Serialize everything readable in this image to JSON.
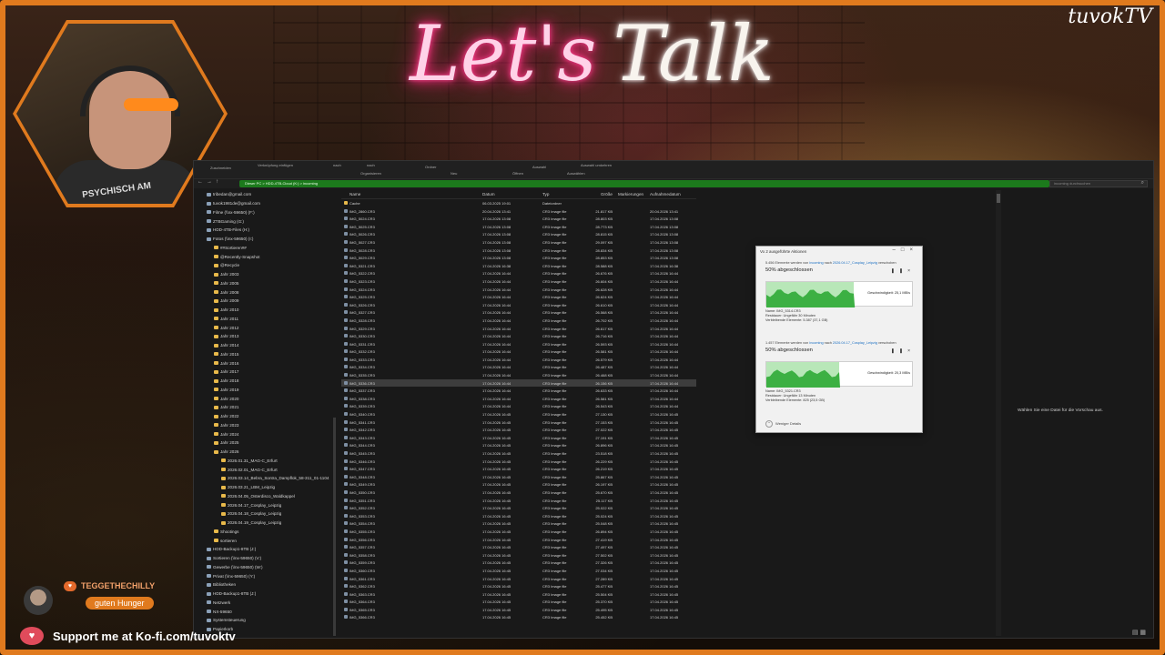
{
  "stream": {
    "title_part1": "Let's",
    "title_part2": "Talk",
    "brand": "tuvokTV",
    "shirt_text": "PSYCHISCH AM",
    "chat": {
      "user": "TEGGETHECHILLY",
      "message": "guten Hunger"
    },
    "support_text": "Support me at Ko-fi.com/tuvoktv",
    "accent_color": "#e07a1e"
  },
  "explorer": {
    "ribbon": [
      "Zuschneiden",
      "Verknüpfung einfügen",
      "nach",
      "nach",
      "Ordner",
      "Auswahl",
      "Auswahl umkehren",
      "Organisieren",
      "Neu",
      "Öffnen",
      "Auswählen"
    ],
    "address_path": "Dieser PC  >  HDD-4TB-Cloud (K:)  >  incoming",
    "search_placeholder": "incoming durchsuchen",
    "nav_items": [
      {
        "label": "tribedan@gmail.com",
        "kind": "drive"
      },
      {
        "label": "tuvok1981de@gmail.com",
        "kind": "drive"
      },
      {
        "label": "Filme (\\\\nx-59650) (F:)",
        "kind": "drive"
      },
      {
        "label": "ZTBGaming (G:)",
        "kind": "drive"
      },
      {
        "label": "HDD-4TB-Files (H:)",
        "kind": "drive"
      },
      {
        "label": "Fotos (\\\\nx-59650) (I:)",
        "kind": "drive"
      },
      {
        "label": "##Sortieren##",
        "kind": "folder"
      },
      {
        "label": "@Recently-Snapshot",
        "kind": "folder"
      },
      {
        "label": "@Recycle",
        "kind": "folder"
      },
      {
        "label": "Jahr 2003",
        "kind": "folder"
      },
      {
        "label": "Jahr 2005",
        "kind": "folder"
      },
      {
        "label": "Jahr 2008",
        "kind": "folder"
      },
      {
        "label": "Jahr 2009",
        "kind": "folder"
      },
      {
        "label": "Jahr 2010",
        "kind": "folder"
      },
      {
        "label": "Jahr 2011",
        "kind": "folder"
      },
      {
        "label": "Jahr 2012",
        "kind": "folder"
      },
      {
        "label": "Jahr 2013",
        "kind": "folder"
      },
      {
        "label": "Jahr 2014",
        "kind": "folder"
      },
      {
        "label": "Jahr 2015",
        "kind": "folder"
      },
      {
        "label": "Jahr 2016",
        "kind": "folder"
      },
      {
        "label": "Jahr 2017",
        "kind": "folder"
      },
      {
        "label": "Jahr 2018",
        "kind": "folder"
      },
      {
        "label": "Jahr 2019",
        "kind": "folder"
      },
      {
        "label": "Jahr 2020",
        "kind": "folder"
      },
      {
        "label": "Jahr 2021",
        "kind": "folder"
      },
      {
        "label": "Jahr 2022",
        "kind": "folder"
      },
      {
        "label": "Jahr 2023",
        "kind": "folder"
      },
      {
        "label": "Jahr 2024",
        "kind": "folder"
      },
      {
        "label": "Jahr 2025",
        "kind": "folder"
      },
      {
        "label": "Jahr 2026",
        "kind": "folder"
      },
      {
        "label": "2026.01.31_MAG-C_Erfurt",
        "kind": "folder"
      },
      {
        "label": "2026.02.01_MAG-C_Erfurt",
        "kind": "folder"
      },
      {
        "label": "2026.03.14_Bebra_Sontra_Dampflok_58-311_01-1104",
        "kind": "folder"
      },
      {
        "label": "2026.03.21_LBM_Leipzig",
        "kind": "folder"
      },
      {
        "label": "2026.04.05_Osterdisco_Waldkappel",
        "kind": "folder"
      },
      {
        "label": "2026.04.17_Cosplay_Leipzig",
        "kind": "folder"
      },
      {
        "label": "2026.04.18_Cosplay_Leipzig",
        "kind": "folder"
      },
      {
        "label": "2026.04.19_Cosplay_Leipzig",
        "kind": "folder"
      },
      {
        "label": "Shootings",
        "kind": "folder"
      },
      {
        "label": "sortieren",
        "kind": "folder"
      },
      {
        "label": "HDD-Backup1-8TB (J:)",
        "kind": "drive"
      },
      {
        "label": "Sortieren (\\\\nx-59650) (V:)",
        "kind": "drive"
      },
      {
        "label": "Gewerbe (\\\\nx-59650) (W:)",
        "kind": "drive"
      },
      {
        "label": "Privat (\\\\nx-59650) (Y:)",
        "kind": "drive"
      },
      {
        "label": "Bibliotheken",
        "kind": "drive"
      },
      {
        "label": "HDD-Backup1-8TB (J:)",
        "kind": "drive"
      },
      {
        "label": "Netzwerk",
        "kind": "drive"
      },
      {
        "label": "NX-59650",
        "kind": "drive"
      },
      {
        "label": "Systemsteuerung",
        "kind": "drive"
      },
      {
        "label": "Papierkorb",
        "kind": "drive"
      }
    ],
    "columns": {
      "name": "Name",
      "date": "Datum",
      "type": "Typ",
      "size": "Größe",
      "marks": "Markierungen",
      "shot": "Aufnahmedatum"
    },
    "files": [
      {
        "name": "Cache",
        "date": "06.03.2025 19:01",
        "type": "Dateiordner",
        "size": "",
        "shot": "",
        "folder": true
      },
      {
        "name": "IMG_2860.CR3",
        "date": "20.04.2026 13:41",
        "type": "CR3 Image file",
        "size": "21.817 KB",
        "shot": "20.04.2026 13:41"
      },
      {
        "name": "IMG_5024.CR3",
        "date": "17.04.2026 13:08",
        "type": "CR3 Image file",
        "size": "28.803 KB",
        "shot": "17.04.2026 13:08"
      },
      {
        "name": "IMG_5025.CR3",
        "date": "17.04.2026 13:08",
        "type": "CR3 Image file",
        "size": "28.773 KB",
        "shot": "17.04.2026 13:08"
      },
      {
        "name": "IMG_5026.CR3",
        "date": "17.04.2026 13:08",
        "type": "CR3 Image file",
        "size": "28.815 KB",
        "shot": "17.04.2026 13:08"
      },
      {
        "name": "IMG_5027.CR3",
        "date": "17.04.2026 13:08",
        "type": "CR3 Image file",
        "size": "29.097 KB",
        "shot": "17.04.2026 13:08"
      },
      {
        "name": "IMG_5028.CR3",
        "date": "17.04.2026 13:08",
        "type": "CR3 Image file",
        "size": "28.834 KB",
        "shot": "17.04.2026 13:08"
      },
      {
        "name": "IMG_5029.CR3",
        "date": "17.04.2026 13:08",
        "type": "CR3 Image file",
        "size": "28.853 KB",
        "shot": "17.04.2026 13:08"
      },
      {
        "name": "IMG_5321.CR3",
        "date": "17.04.2026 16:38",
        "type": "CR3 Image file",
        "size": "28.588 KB",
        "shot": "17.04.2026 16:38"
      },
      {
        "name": "IMG_5322.CR3",
        "date": "17.04.2026 16:44",
        "type": "CR3 Image file",
        "size": "26.676 KB",
        "shot": "17.04.2026 16:44"
      },
      {
        "name": "IMG_5323.CR3",
        "date": "17.04.2026 16:44",
        "type": "CR3 Image file",
        "size": "26.604 KB",
        "shot": "17.04.2026 16:44"
      },
      {
        "name": "IMG_5324.CR3",
        "date": "17.04.2026 16:44",
        "type": "CR3 Image file",
        "size": "26.628 KB",
        "shot": "17.04.2026 16:44"
      },
      {
        "name": "IMG_5325.CR3",
        "date": "17.04.2026 16:44",
        "type": "CR3 Image file",
        "size": "26.624 KB",
        "shot": "17.04.2026 16:44"
      },
      {
        "name": "IMG_5326.CR3",
        "date": "17.04.2026 16:44",
        "type": "CR3 Image file",
        "size": "26.610 KB",
        "shot": "17.04.2026 16:44"
      },
      {
        "name": "IMG_5327.CR3",
        "date": "17.04.2026 16:44",
        "type": "CR3 Image file",
        "size": "26.568 KB",
        "shot": "17.04.2026 16:44"
      },
      {
        "name": "IMG_5328.CR3",
        "date": "17.04.2026 16:44",
        "type": "CR3 Image file",
        "size": "26.702 KB",
        "shot": "17.04.2026 16:44"
      },
      {
        "name": "IMG_5329.CR3",
        "date": "17.04.2026 16:44",
        "type": "CR3 Image file",
        "size": "26.617 KB",
        "shot": "17.04.2026 16:44"
      },
      {
        "name": "IMG_5330.CR3",
        "date": "17.04.2026 16:44",
        "type": "CR3 Image file",
        "size": "26.716 KB",
        "shot": "17.04.2026 16:44"
      },
      {
        "name": "IMG_5331.CR3",
        "date": "17.04.2026 16:44",
        "type": "CR3 Image file",
        "size": "26.593 KB",
        "shot": "17.04.2026 16:44"
      },
      {
        "name": "IMG_5332.CR3",
        "date": "17.04.2026 16:44",
        "type": "CR3 Image file",
        "size": "26.581 KB",
        "shot": "17.04.2026 16:44"
      },
      {
        "name": "IMG_5333.CR3",
        "date": "17.04.2026 16:44",
        "type": "CR3 Image file",
        "size": "26.579 KB",
        "shot": "17.04.2026 16:44"
      },
      {
        "name": "IMG_5334.CR3",
        "date": "17.04.2026 16:44",
        "type": "CR3 Image file",
        "size": "26.487 KB",
        "shot": "17.04.2026 16:44"
      },
      {
        "name": "IMG_5335.CR3",
        "date": "17.04.2026 16:44",
        "type": "CR3 Image file",
        "size": "26.468 KB",
        "shot": "17.04.2026 16:44"
      },
      {
        "name": "IMG_5336.CR3",
        "date": "17.04.2026 16:44",
        "type": "CR3 Image file",
        "size": "26.156 KB",
        "shot": "17.04.2026 16:44",
        "selected": true
      },
      {
        "name": "IMG_5337.CR3",
        "date": "17.04.2026 16:44",
        "type": "CR3 Image file",
        "size": "26.633 KB",
        "shot": "17.04.2026 16:44"
      },
      {
        "name": "IMG_5338.CR3",
        "date": "17.04.2026 16:44",
        "type": "CR3 Image file",
        "size": "26.581 KB",
        "shot": "17.04.2026 16:44"
      },
      {
        "name": "IMG_5339.CR3",
        "date": "17.04.2026 16:44",
        "type": "CR3 Image file",
        "size": "26.543 KB",
        "shot": "17.04.2026 16:44"
      },
      {
        "name": "IMG_5340.CR3",
        "date": "17.04.2026 16:45",
        "type": "CR3 Image file",
        "size": "27.130 KB",
        "shot": "17.04.2026 16:45"
      },
      {
        "name": "IMG_5341.CR3",
        "date": "17.04.2026 16:45",
        "type": "CR3 Image file",
        "size": "27.153 KB",
        "shot": "17.04.2026 16:45"
      },
      {
        "name": "IMG_5342.CR3",
        "date": "17.04.2026 16:45",
        "type": "CR3 Image file",
        "size": "27.022 KB",
        "shot": "17.04.2026 16:45"
      },
      {
        "name": "IMG_5343.CR3",
        "date": "17.04.2026 16:45",
        "type": "CR3 Image file",
        "size": "27.191 KB",
        "shot": "17.04.2026 16:45"
      },
      {
        "name": "IMG_5344.CR3",
        "date": "17.04.2026 16:45",
        "type": "CR3 Image file",
        "size": "26.896 KB",
        "shot": "17.04.2026 16:45"
      },
      {
        "name": "IMG_5345.CR3",
        "date": "17.04.2026 16:45",
        "type": "CR3 Image file",
        "size": "23.518 KB",
        "shot": "17.04.2026 16:45"
      },
      {
        "name": "IMG_5346.CR3",
        "date": "17.04.2026 16:45",
        "type": "CR3 Image file",
        "size": "26.229 KB",
        "shot": "17.04.2026 16:45"
      },
      {
        "name": "IMG_5347.CR3",
        "date": "17.04.2026 16:45",
        "type": "CR3 Image file",
        "size": "26.219 KB",
        "shot": "17.04.2026 16:45"
      },
      {
        "name": "IMG_5348.CR3",
        "date": "17.04.2026 16:45",
        "type": "CR3 Image file",
        "size": "25.867 KB",
        "shot": "17.04.2026 16:45"
      },
      {
        "name": "IMG_5349.CR3",
        "date": "17.04.2026 16:45",
        "type": "CR3 Image file",
        "size": "26.197 KB",
        "shot": "17.04.2026 16:45"
      },
      {
        "name": "IMG_5350.CR3",
        "date": "17.04.2026 16:45",
        "type": "CR3 Image file",
        "size": "25.670 KB",
        "shot": "17.04.2026 16:45"
      },
      {
        "name": "IMG_5351.CR3",
        "date": "17.04.2026 16:45",
        "type": "CR3 Image file",
        "size": "25.117 KB",
        "shot": "17.04.2026 16:45"
      },
      {
        "name": "IMG_5352.CR3",
        "date": "17.04.2026 16:45",
        "type": "CR3 Image file",
        "size": "25.022 KB",
        "shot": "17.04.2026 16:45"
      },
      {
        "name": "IMG_5353.CR3",
        "date": "17.04.2026 16:45",
        "type": "CR3 Image file",
        "size": "25.024 KB",
        "shot": "17.04.2026 16:45"
      },
      {
        "name": "IMG_5354.CR3",
        "date": "17.04.2026 16:45",
        "type": "CR3 Image file",
        "size": "25.048 KB",
        "shot": "17.04.2026 16:45"
      },
      {
        "name": "IMG_5355.CR3",
        "date": "17.04.2026 16:45",
        "type": "CR3 Image file",
        "size": "26.894 KB",
        "shot": "17.04.2026 16:45"
      },
      {
        "name": "IMG_5356.CR3",
        "date": "17.04.2026 16:45",
        "type": "CR3 Image file",
        "size": "27.419 KB",
        "shot": "17.04.2026 16:45"
      },
      {
        "name": "IMG_5357.CR3",
        "date": "17.04.2026 16:45",
        "type": "CR3 Image file",
        "size": "27.497 KB",
        "shot": "17.04.2026 16:45"
      },
      {
        "name": "IMG_5358.CR3",
        "date": "17.04.2026 16:45",
        "type": "CR3 Image file",
        "size": "27.502 KB",
        "shot": "17.04.2026 16:45"
      },
      {
        "name": "IMG_5359.CR3",
        "date": "17.04.2026 16:45",
        "type": "CR3 Image file",
        "size": "27.326 KB",
        "shot": "17.04.2026 16:45"
      },
      {
        "name": "IMG_5360.CR3",
        "date": "17.04.2026 16:45",
        "type": "CR3 Image file",
        "size": "27.034 KB",
        "shot": "17.04.2026 16:45"
      },
      {
        "name": "IMG_5361.CR3",
        "date": "17.04.2026 16:45",
        "type": "CR3 Image file",
        "size": "27.289 KB",
        "shot": "17.04.2026 16:45"
      },
      {
        "name": "IMG_5362.CR3",
        "date": "17.04.2026 16:45",
        "type": "CR3 Image file",
        "size": "25.477 KB",
        "shot": "17.04.2026 16:45"
      },
      {
        "name": "IMG_5363.CR3",
        "date": "17.04.2026 16:45",
        "type": "CR3 Image file",
        "size": "25.504 KB",
        "shot": "17.04.2026 16:45"
      },
      {
        "name": "IMG_5364.CR3",
        "date": "17.04.2026 16:45",
        "type": "CR3 Image file",
        "size": "25.370 KB",
        "shot": "17.04.2026 16:45"
      },
      {
        "name": "IMG_5365.CR3",
        "date": "17.04.2026 16:45",
        "type": "CR3 Image file",
        "size": "25.495 KB",
        "shot": "17.04.2026 16:45"
      },
      {
        "name": "IMG_5366.CR3",
        "date": "17.04.2026 16:45",
        "type": "CR3 Image file",
        "size": "25.452 KB",
        "shot": "17.04.2026 16:45"
      }
    ],
    "preview_message": "Wählen Sie eine Datei für die Vorschau aus."
  },
  "copy_dialog": {
    "title": "Vo 2 ausgeführte Aktionen",
    "jobs": [
      {
        "description": "5.456 Elemente werden von",
        "from": "incoming",
        "to_text": "nach",
        "target": "2026.04.17_Cosplay_Leipzig",
        "suffix": "verschoben",
        "percent_label": "50% abgeschlossen",
        "progress": 0.6,
        "speed": "Geschwindigkeit: 25,1 MB/s",
        "name": "Name: IMG_5314.CR3",
        "remaining_time": "Restdauer: Ungefähr 30 Minuten",
        "remaining_items": "Verbleibende Elemente: 5.387 (37,1 GB)",
        "green_color": "#3cb043"
      },
      {
        "description": "1.457 Elemente werden von",
        "from": "incoming",
        "to_text": "nach",
        "target": "2026.04.17_Cosplay_Leipzig",
        "suffix": "verschoben",
        "percent_label": "50% abgeschlossen",
        "progress": 0.5,
        "speed": "Geschwindigkeit: 20,3 MB/s",
        "name": "Name: IMG_5321.CR3",
        "remaining_time": "Restdauer: Ungefähr 13 Minuten",
        "remaining_items": "Verbleibende Elemente: 825 (23,5 GB)",
        "green_color": "#3cb043"
      }
    ],
    "less_details": "Weniger Details"
  }
}
